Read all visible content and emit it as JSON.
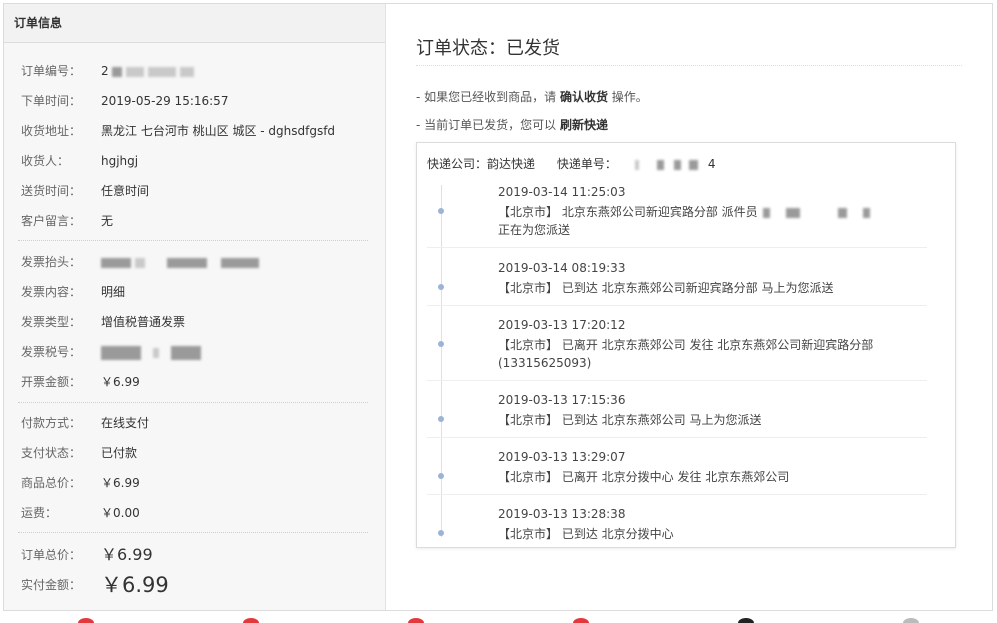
{
  "left": {
    "header": "订单信息",
    "order_info": [
      {
        "label": "订单编号：",
        "value": "2"
      },
      {
        "label": "下单时间：",
        "value": "2019-05-29 15:16:57"
      },
      {
        "label": "收货地址：",
        "value": "黑龙江 七台河市 桃山区 城区 - dghsdfgsfd"
      },
      {
        "label": "收货人：",
        "value": "hgjhgj"
      },
      {
        "label": "送货时间：",
        "value": "任意时间"
      },
      {
        "label": "客户留言：",
        "value": "无"
      }
    ],
    "invoice": [
      {
        "label": "发票抬头：",
        "value": ""
      },
      {
        "label": "发票内容：",
        "value": "明细"
      },
      {
        "label": "发票类型：",
        "value": "增值税普通发票"
      },
      {
        "label": "发票税号：",
        "value": ""
      },
      {
        "label": "开票金额：",
        "value": "￥6.99"
      }
    ],
    "payment": [
      {
        "label": "付款方式：",
        "value": "在线支付"
      },
      {
        "label": "支付状态：",
        "value": "已付款"
      },
      {
        "label": "商品总价：",
        "value": "￥6.99"
      },
      {
        "label": "运费：",
        "value": "￥0.00"
      }
    ],
    "totals": {
      "order_total_label": "订单总价：",
      "order_total": "￥6.99",
      "paid_label": "实付金额：",
      "paid": "￥6.99"
    }
  },
  "right": {
    "status_title": "订单状态：已发货",
    "tip1": {
      "prefix": "- 如果您已经收到商品，请 ",
      "action": "确认收货",
      "suffix": " 操作。"
    },
    "tip2": {
      "prefix": "- 当前订单已发货，您可以 ",
      "action": "刷新快递"
    },
    "express": {
      "company": "快递公司：韵达快递",
      "tracking_label": "快递单号：",
      "tracking_suffix": "4",
      "events": [
        {
          "time": "2019-03-14 11:25:03",
          "desc": "【北京市】 北京东燕郊公司新迎宾路分部 派件员",
          "desc2": "正在为您派送"
        },
        {
          "time": "2019-03-14 08:19:33",
          "desc": "【北京市】 已到达 北京东燕郊公司新迎宾路分部 马上为您派送",
          "desc2": ""
        },
        {
          "time": "2019-03-13 17:20:12",
          "desc": "【北京市】 已离开 北京东燕郊公司 发往 北京东燕郊公司新迎宾路分部",
          "desc2": "(13315625093)"
        },
        {
          "time": "2019-03-13 17:15:36",
          "desc": "【北京市】 已到达 北京东燕郊公司 马上为您派送",
          "desc2": ""
        },
        {
          "time": "2019-03-13 13:29:07",
          "desc": "【北京市】 已离开 北京分拨中心 发往 北京东燕郊公司",
          "desc2": ""
        },
        {
          "time": "2019-03-13 13:28:38",
          "desc": "【北京市】 已到达 北京分拨中心",
          "desc2": ""
        }
      ]
    }
  },
  "colors": {
    "accent_blue": "#2f9fd8",
    "price_red": "#e4393c",
    "timeline_dot": "#9bb4d6"
  }
}
